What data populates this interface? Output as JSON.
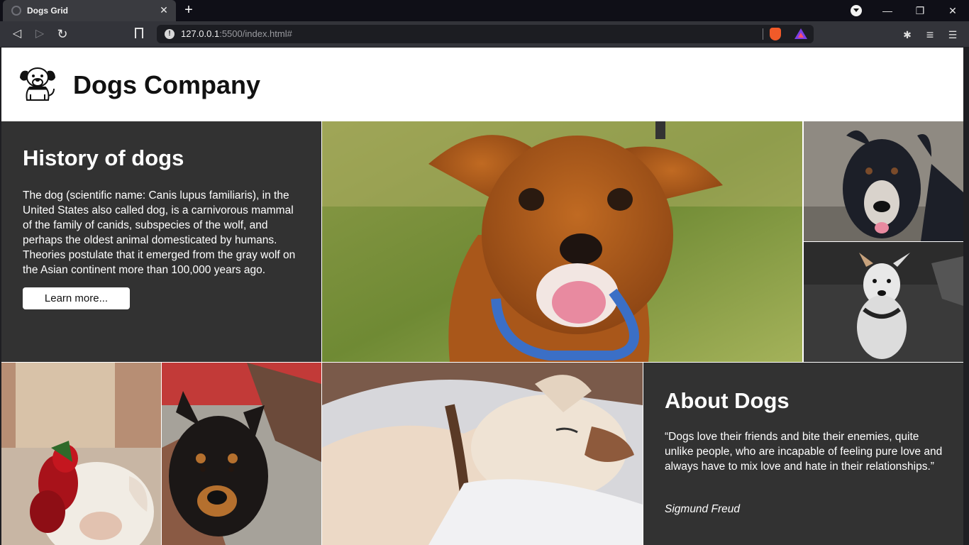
{
  "browser": {
    "tab_title": "Dogs Grid",
    "tab_close": "✕",
    "new_tab": "+",
    "url_host": "127.0.0.1",
    "url_rest": ":5500/index.html#",
    "info": "!",
    "minimize": "—",
    "restore": "❐",
    "close": "✕",
    "back": "◁",
    "forward": "▷",
    "reload": "↻",
    "extensions": "✱",
    "playlist": "≡",
    "menu": "☰"
  },
  "header": {
    "company_name": "Dogs Company"
  },
  "history": {
    "title": "History of dogs",
    "body": "The dog (scientific name: Canis lupus familiaris), in the United States also called dog, is a carnivorous mammal of the family of canids, subspecies of the wolf, and perhaps the oldest animal domesticated by humans. Theories postulate that it emerged from the gray wolf on the Asian continent more than 100,000 years ago.",
    "button": "Learn more..."
  },
  "about": {
    "title": "About Dogs",
    "quote": "“Dogs love their friends and bite their enemies, quite unlike people, who are incapable of feeling pure love and always have to mix love and hate in their relationships.”",
    "author": "Sigmund Freud"
  },
  "colors": {
    "panel_dark": "#323232",
    "chrome_dark": "#0f0f17",
    "toolbar": "#33343a"
  }
}
